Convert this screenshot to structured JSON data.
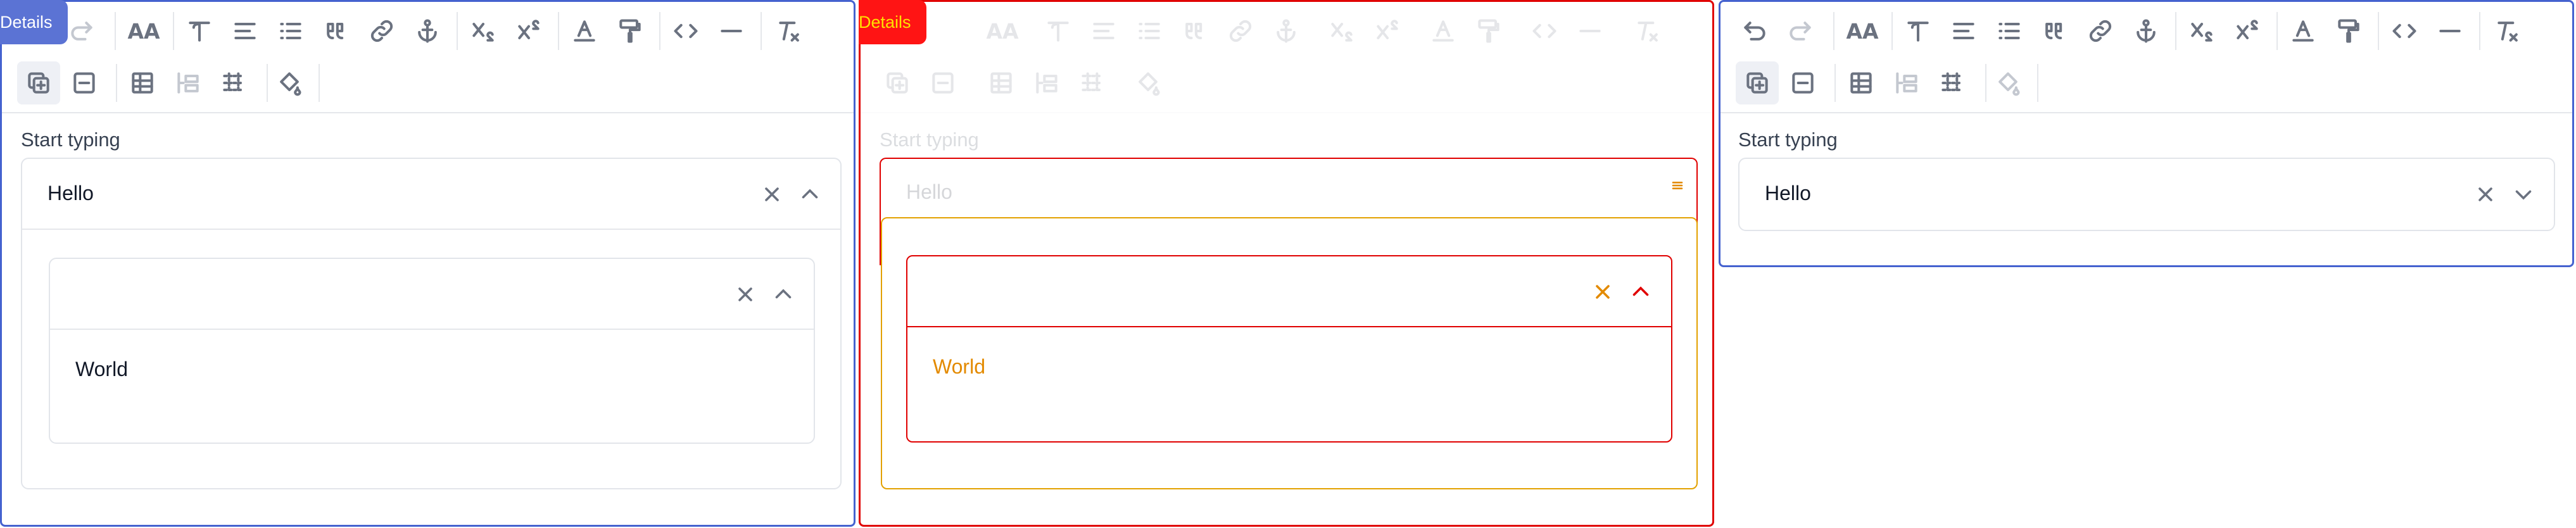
{
  "badge": {
    "label": "Details"
  },
  "editor": {
    "label": "Start typing",
    "outer_value": "Hello",
    "inner_value": "World"
  },
  "toolbar": {
    "row1": [
      "undo-icon",
      "redo-icon",
      "font-size-icon",
      "heading-icon",
      "align-icon",
      "bullet-list-icon",
      "quote-icon",
      "link-icon",
      "anchor-icon",
      "subscript-icon",
      "superscript-icon",
      "text-color-icon",
      "paint-roller-icon",
      "code-icon",
      "horizontal-rule-icon",
      "clear-format-icon"
    ],
    "row2": [
      "add-block-icon",
      "remove-block-icon",
      "table-icon",
      "merge-cells-icon",
      "split-cells-icon",
      "cell-fill-icon"
    ]
  },
  "colors": {
    "blue_accent": "#4562cf",
    "red_accent": "#e00000",
    "orange_accent": "#e38a00"
  }
}
